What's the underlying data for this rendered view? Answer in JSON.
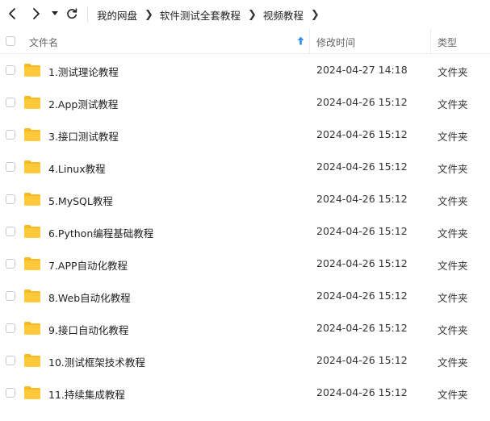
{
  "breadcrumb": [
    "我的网盘",
    "软件测试全套教程",
    "视频教程"
  ],
  "columns": {
    "name": "文件名",
    "modified": "修改时间",
    "type": "类型"
  },
  "colors": {
    "accent": "#2f8cf0",
    "folder": "#fdc233"
  },
  "files": [
    {
      "name": "1.测试理论教程",
      "modified": "2024-04-27 14:18",
      "type": "文件夹"
    },
    {
      "name": "2.App测试教程",
      "modified": "2024-04-26 15:12",
      "type": "文件夹"
    },
    {
      "name": "3.接口测试教程",
      "modified": "2024-04-26 15:12",
      "type": "文件夹"
    },
    {
      "name": "4.Linux教程",
      "modified": "2024-04-26 15:12",
      "type": "文件夹"
    },
    {
      "name": "5.MySQL教程",
      "modified": "2024-04-26 15:12",
      "type": "文件夹"
    },
    {
      "name": "6.Python编程基础教程",
      "modified": "2024-04-26 15:12",
      "type": "文件夹"
    },
    {
      "name": "7.APP自动化教程",
      "modified": "2024-04-26 15:12",
      "type": "文件夹"
    },
    {
      "name": "8.Web自动化教程",
      "modified": "2024-04-26 15:12",
      "type": "文件夹"
    },
    {
      "name": "9.接口自动化教程",
      "modified": "2024-04-26 15:12",
      "type": "文件夹"
    },
    {
      "name": "10.测试框架技术教程",
      "modified": "2024-04-26 15:12",
      "type": "文件夹"
    },
    {
      "name": "11.持续集成教程",
      "modified": "2024-04-26 15:12",
      "type": "文件夹"
    }
  ]
}
